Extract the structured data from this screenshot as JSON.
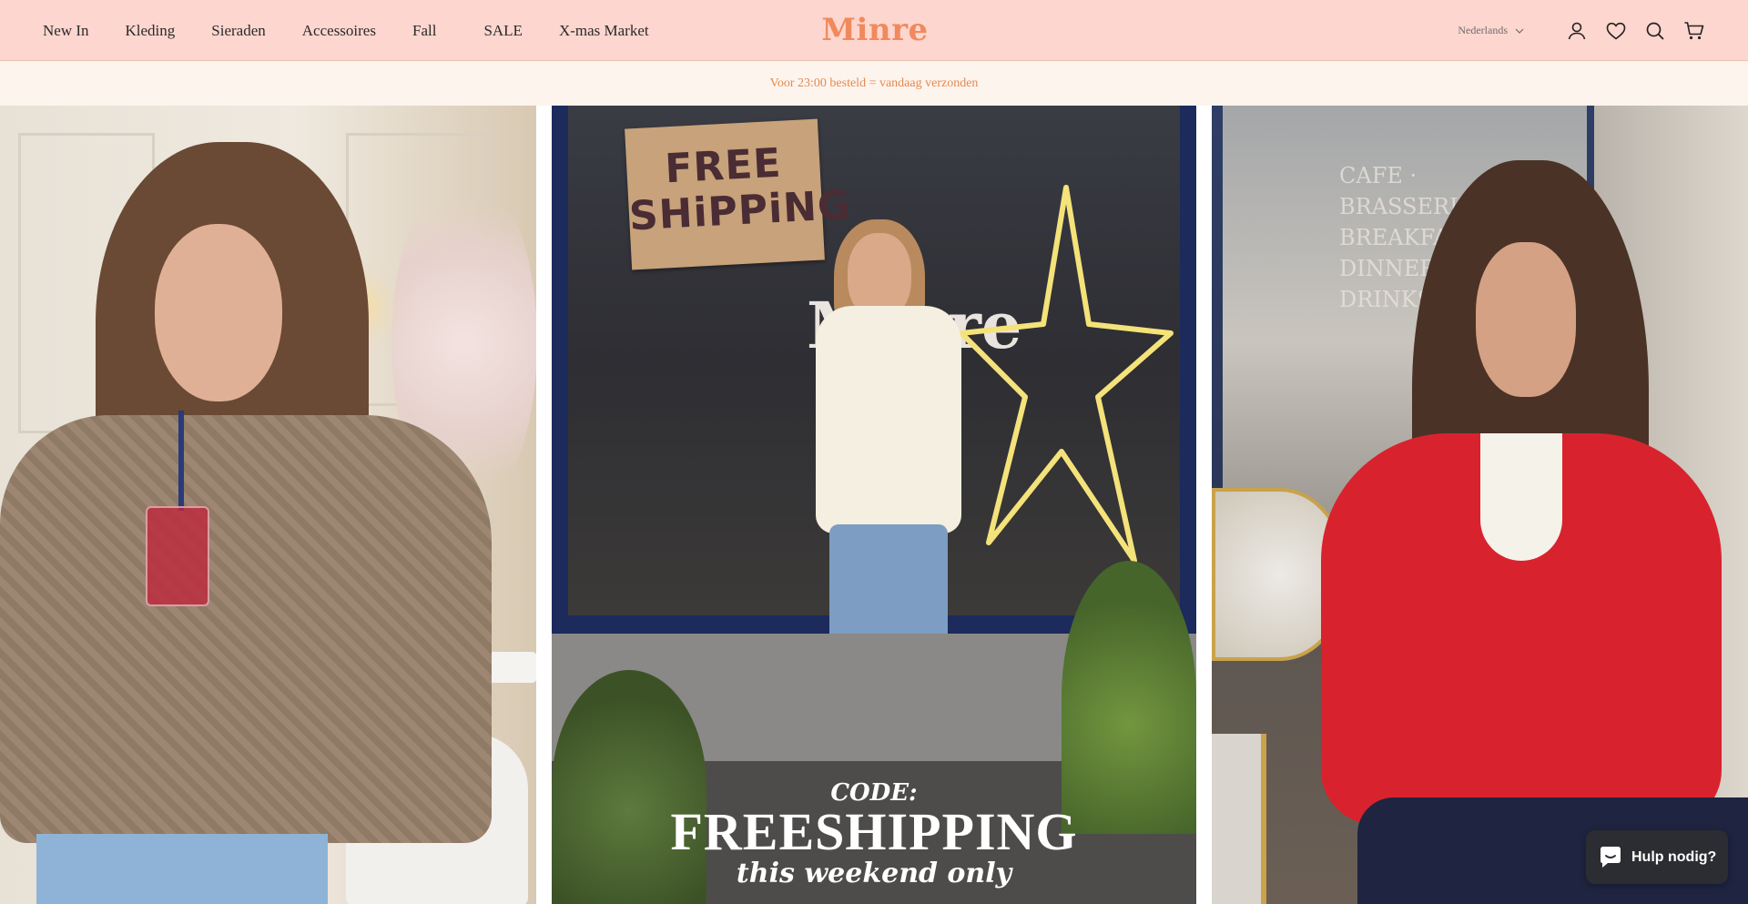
{
  "header": {
    "nav": [
      {
        "label": "New In"
      },
      {
        "label": "Kleding"
      },
      {
        "label": "Sieraden"
      },
      {
        "label": "Accessoires"
      },
      {
        "label": "Fall"
      },
      {
        "label": "SALE"
      },
      {
        "label": "X-mas Market"
      }
    ],
    "logo": "Minre",
    "language": "Nederlands",
    "icons": [
      "account-icon",
      "wishlist-heart-icon",
      "search-icon",
      "cart-icon"
    ],
    "background_color": "#fdd6cf",
    "logo_color": "#f08a5d"
  },
  "announcement": {
    "text": "Voor 23:00 besteld = vandaag verzonden",
    "color": "#e48a4c"
  },
  "hero": {
    "center_panel": {
      "sign_text": "FREE SHiPPiNG",
      "store_name": "Minre",
      "code_label": "CODE:",
      "code_value": "FREESHIPPING",
      "code_note": "this weekend only"
    },
    "right_panel": {
      "window_text": "CAFE · BRASSERIE BREAKFAST DINNER DRINKS"
    }
  },
  "chat": {
    "label": "Hulp nodig?",
    "icon": "chat-bubble-icon"
  }
}
